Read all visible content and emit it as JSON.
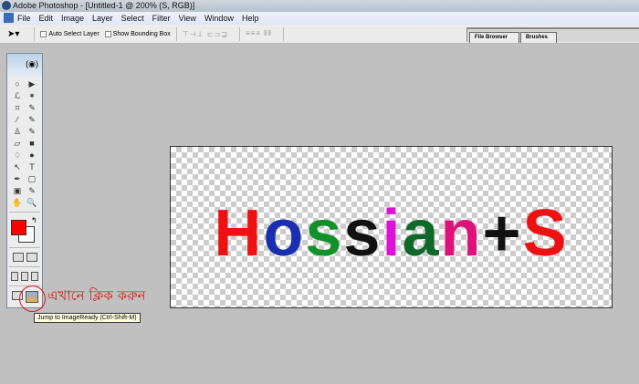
{
  "window": {
    "title": "Adobe Photoshop - [Untitled-1 @ 200% (S, RGB)]"
  },
  "menu": [
    "File",
    "Edit",
    "Image",
    "Layer",
    "Select",
    "Filter",
    "View",
    "Window",
    "Help"
  ],
  "options": {
    "tool_icon": "move-tool",
    "auto_select": "Auto Select Layer",
    "bounding_box": "Show Bounding Box"
  },
  "palette_tabs": [
    "File Browser",
    "Brushes"
  ],
  "tools": [
    "○",
    "▶",
    "ℒ",
    "✶",
    "⌗",
    "✎",
    "⁄",
    "✎",
    "♙",
    "✎",
    "▱",
    "■",
    "♢",
    "●",
    "↖",
    "T",
    "✒",
    "▢",
    "▣",
    "✎",
    "✋",
    "🔍"
  ],
  "colors": {
    "foreground": "#ff0000",
    "background": "#ffffff"
  },
  "annotation": "এখানে ক্লিক করুন",
  "tooltip": "Jump to ImageReady (Ctrl-Shift-M)",
  "canvas_text": [
    {
      "ch": "H",
      "color": "#ee1111"
    },
    {
      "ch": "o",
      "color": "#1a2fb0"
    },
    {
      "ch": "s",
      "color": "#12902a"
    },
    {
      "ch": "s",
      "color": "#111111"
    },
    {
      "ch": "i",
      "color": "#e010d8"
    },
    {
      "ch": "a",
      "color": "#0f6a2a"
    },
    {
      "ch": "n",
      "color": "#e0107a"
    },
    {
      "ch": "+",
      "color": "#111111"
    },
    {
      "ch": "S",
      "color": "#ee1111"
    }
  ]
}
